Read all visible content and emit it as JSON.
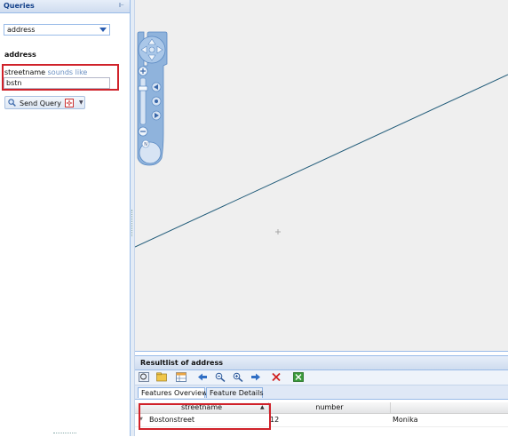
{
  "queries_panel": {
    "title": "Queries",
    "pin_icon": "pin-icon",
    "feature_type": "address",
    "section_title": "address",
    "field": {
      "name": "streetname",
      "operator": "sounds like",
      "value": "bstn"
    },
    "send_query_label": "Send Query"
  },
  "map": {
    "background_color": "#efefef",
    "line_color": "#1f5a78",
    "controls": [
      "pan-up-icon",
      "pan-down-icon",
      "pan-left-icon",
      "pan-right-icon",
      "zoom-in-icon",
      "zoom-out-icon",
      "north-arrow-icon"
    ],
    "north_label": "N"
  },
  "results": {
    "title": "Resultlist of address",
    "tabs": [
      {
        "label": "Features Overview",
        "active": true
      },
      {
        "label": "Feature Details",
        "active": false
      }
    ],
    "columns": [
      "streetname",
      "number"
    ],
    "rows": [
      {
        "streetname": "Bostonstreet",
        "number": "12",
        "extra": "Monika"
      }
    ]
  },
  "colors": {
    "panel_border": "#99bbe8",
    "highlight": "#d0222a",
    "header_text": "#15428b"
  }
}
